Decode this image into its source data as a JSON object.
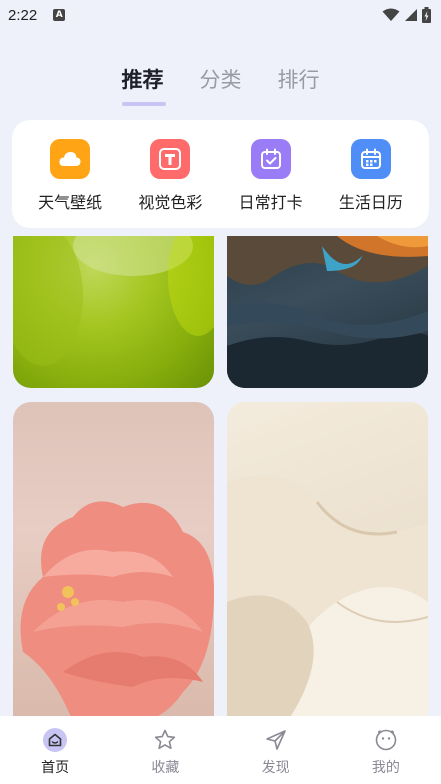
{
  "status_bar": {
    "time": "2:22",
    "notification_badge": "A"
  },
  "top_tabs": [
    {
      "label": "推荐",
      "active": true
    },
    {
      "label": "分类",
      "active": false
    },
    {
      "label": "排行",
      "active": false
    }
  ],
  "shortcuts": [
    {
      "label": "天气壁纸",
      "icon": "cloud-icon",
      "color": "#ffa414"
    },
    {
      "label": "视觉色彩",
      "icon": "letter-t-icon",
      "color": "#ff6b6b"
    },
    {
      "label": "日常打卡",
      "icon": "calendar-check-icon",
      "color": "#9b7cf7"
    },
    {
      "label": "生活日历",
      "icon": "calendar-icon",
      "color": "#4f8ef7"
    }
  ],
  "wallpapers": [
    {
      "subject": "green-gradient"
    },
    {
      "subject": "mountain-sunset"
    },
    {
      "subject": "pink-peony"
    },
    {
      "subject": "cream-silk"
    }
  ],
  "bottom_nav": [
    {
      "label": "首页",
      "icon": "home-icon",
      "active": true
    },
    {
      "label": "收藏",
      "icon": "star-icon",
      "active": false
    },
    {
      "label": "发现",
      "icon": "send-icon",
      "active": false
    },
    {
      "label": "我的",
      "icon": "face-icon",
      "active": false
    }
  ],
  "colors": {
    "accent": "#c8c4f4",
    "background": "#eef0fa"
  }
}
